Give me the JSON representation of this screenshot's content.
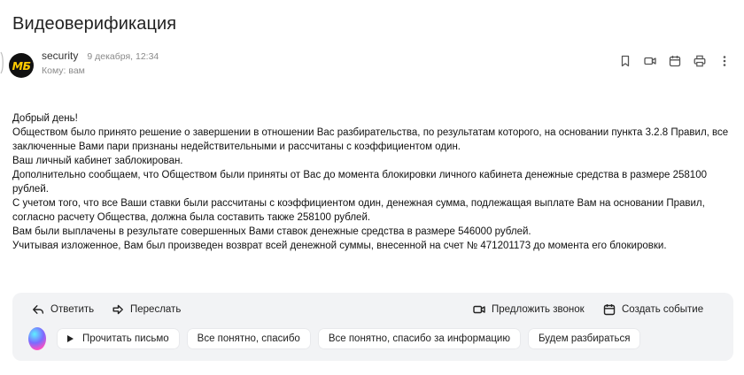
{
  "message": {
    "subject": "Видеоверификация",
    "avatar_text": "МБ",
    "sender": "security",
    "date": "9 декабря, 12:34",
    "to": "Кому: вам"
  },
  "header_actions": [
    {
      "icon": "bookmark-icon"
    },
    {
      "icon": "video-icon"
    },
    {
      "icon": "calendar-icon"
    },
    {
      "icon": "print-icon"
    },
    {
      "icon": "more-vertical-icon"
    }
  ],
  "body": [
    "Добрый день!",
    "Обществом было принято решение о завершении в отношении Вас разбирательства, по результатам которого, на основании пункта 3.2.8 Правил, все заключенные Вами пари признаны недействительными и рассчитаны с коэффициентом один.",
    "Ваш личный кабинет заблокирован.",
    "Дополнительно сообщаем, что Обществом были приняты от Вас до момента блокировки личного кабинета денежные средства в размере 258100 рублей.",
    "С учетом того, что все Ваши ставки были рассчитаны с коэффициентом один, денежная сумма, подлежащая выплате Вам на основании Правил, согласно расчету Общества, должна была составить также 258100 рублей.",
    "Вам были выплачены в результате совершенных Вами ставок денежные средства в размере 546000 рублей.",
    "Учитывая изложенное, Вам был произведен возврат всей денежной суммы, внесенной на счет № 471201173 до момента его блокировки."
  ],
  "actions": {
    "reply": "Ответить",
    "forward": "Переслать",
    "propose_call": "Предложить звонок",
    "create_event": "Создать событие"
  },
  "quick_replies": {
    "read_letter": "Прочитать письмо",
    "reply_1": "Все понятно, спасибо",
    "reply_2": "Все понятно, спасибо за информацию",
    "reply_3": "Будем разбираться"
  },
  "colors": {
    "panel_bg": "#f2f3f5",
    "avatar_bg": "#111111",
    "avatar_text": "#ffcc00"
  }
}
